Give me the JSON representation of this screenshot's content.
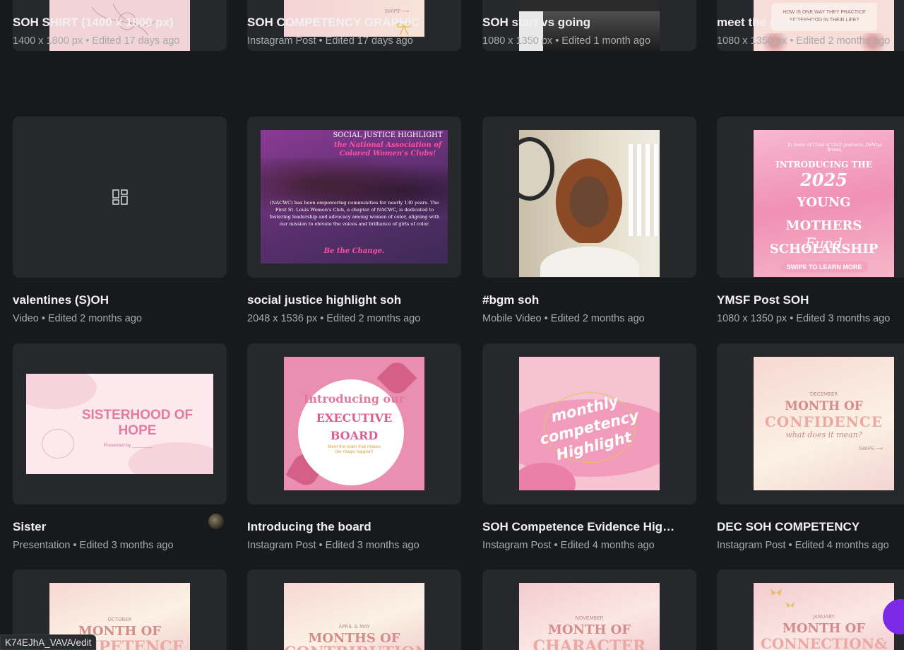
{
  "designs": [
    {
      "title": "SOH SHIRT (1400 x 1800 px)",
      "meta": "1400 x 1800 px • Edited 17 days ago"
    },
    {
      "title": "SOH COMPETENCY GRAPHIC",
      "meta": "Instagram Post • Edited 17 days ago"
    },
    {
      "title": "SOH start vs going",
      "meta": "1080 x 1350 px • Edited 1 month ago"
    },
    {
      "title": "meet the mentors",
      "meta": "1080 x 1350 px • Edited 2 months ago"
    },
    {
      "title": "valentines (S)OH",
      "meta": "Video • Edited 2 months ago"
    },
    {
      "title": "social justice highlight soh",
      "meta": "2048 x 1536 px • Edited 2 months ago"
    },
    {
      "title": "#bgm soh",
      "meta": "Mobile Video • Edited 2 months ago"
    },
    {
      "title": "YMSF Post SOH",
      "meta": "1080 x 1350 px • Edited 3 months ago"
    },
    {
      "title": "Sister",
      "meta": "Presentation • Edited 3 months ago"
    },
    {
      "title": "Introducing the board",
      "meta": "Instagram Post • Edited 3 months ago"
    },
    {
      "title": "SOH Competence Evidence Highli...",
      "meta": "Instagram Post • Edited 4 months ago"
    },
    {
      "title": "DEC SOH COMPETENCY",
      "meta": "Instagram Post • Edited 4 months ago"
    }
  ],
  "thumb_text": {
    "swipe": "SWIPE ⟶",
    "mentors_q": "HOW IS ONE WAY THEY PRACTICE SISTERHOOD IN THEIR LIFE?",
    "sj_head": "SOCIAL JUSTICE HIGHLIGHT",
    "sj_sub": "the National Association of Colored Women's Clubs!",
    "sj_body": "(NACWC) has been empowering communities for nearly 130 years. The First St. Louis Women's Club, a chapter of NACWC, is dedicated to fostering leadership and advocacy among women of color, aligning with our mission to elevate the voices and brilliance of girls of color.",
    "sj_cta": "Be the Change.",
    "ym_top": "In honor of Class of 2022 graduate, DeMiya Brown,",
    "ym_intro": "INTRODUCING THE",
    "ym_year": "2025",
    "ym_main": "YOUNG MOTHERS SCHOLARSHIP",
    "ym_fund": "Fund",
    "ym_swipe": "SWIPE TO LEARN MORE",
    "sis_title": "SISTERHOOD OF HOPE",
    "sis_by": "Presented by ________",
    "ex_intro": "Introducing our",
    "ex_main": "EXECUTIVE BOARD",
    "ex_sub": "Meet the team that makes the magic happen!",
    "mc_text": "monthly competency Highlight",
    "dec_month": "DECEMBER",
    "dec_a": "MONTH OF",
    "dec_b": "CONFIDENCE",
    "dec_c": "what does it mean?",
    "b1_month": "OCTOBER",
    "b1_a": "MONTH OF",
    "b1_b": "COMPETENCE",
    "b2_month": "APRIL & MAY",
    "b2_a": "MONTHS OF",
    "b2_b": "CONTRIBUTION",
    "b3_month": "NOVEMBER",
    "b3_a": "MONTH OF",
    "b3_b": "CHARACTER",
    "b4_month": "JANUARY",
    "b4_a": "MONTH OF",
    "b4_b": "CONNECTION&"
  },
  "status_url": "K74EJhA_VAVA/edit",
  "colors": {
    "background": "#18191b",
    "card": "#27282c",
    "accent": "#7d2ae8"
  }
}
